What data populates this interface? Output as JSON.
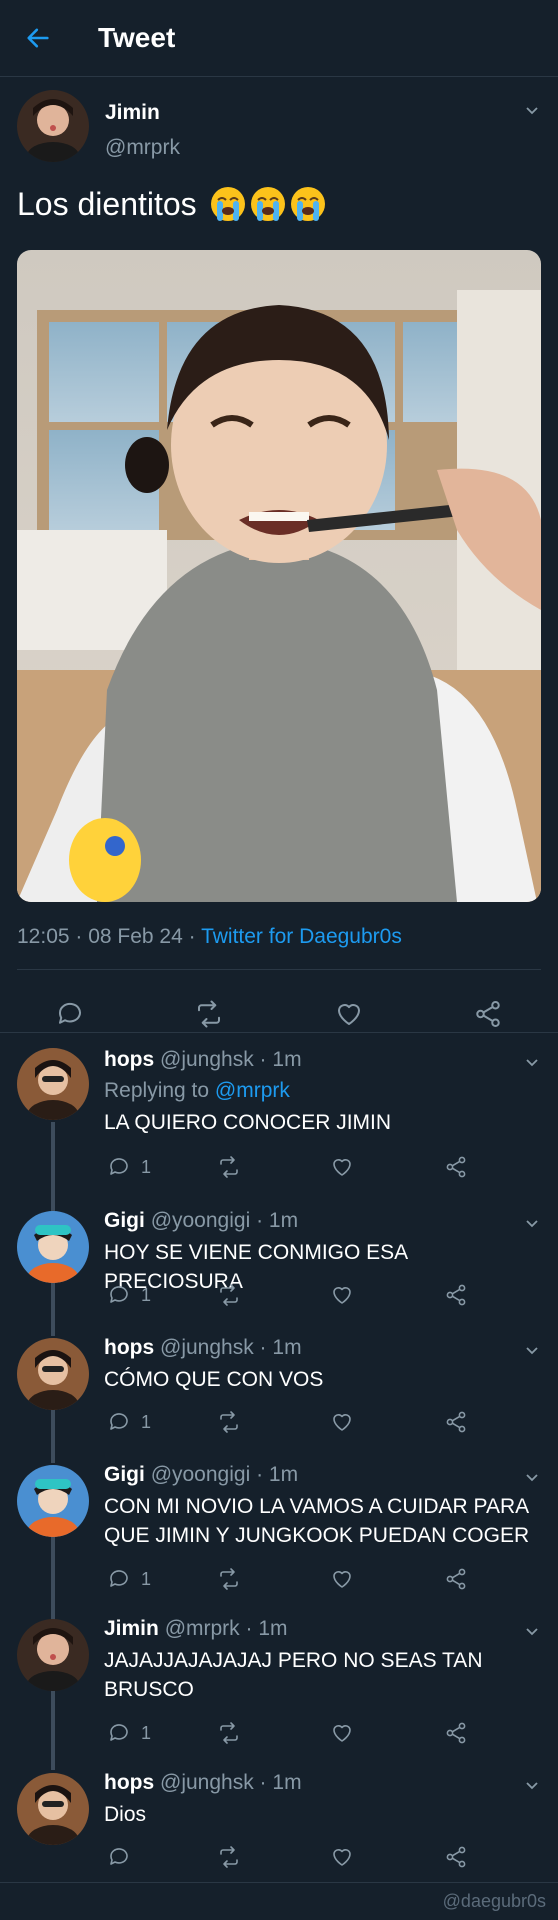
{
  "header": {
    "title": "Tweet",
    "back_icon": "arrow-left-icon"
  },
  "tweet": {
    "author_name": "Jimin",
    "author_handle": "@mrprk",
    "text": "Los dientitos",
    "emojis": [
      "loudly-crying-face",
      "loudly-crying-face",
      "loudly-crying-face"
    ],
    "time": "12:05 · 08 Feb 24 · ",
    "source": "Twitter for Daegubr0s",
    "photo_alt": "photo"
  },
  "replies": [
    {
      "name": "hops",
      "handle": "@junghsk",
      "time": "1m",
      "replying_label": "Replying to ",
      "replying_to": "@mrprk",
      "text": "LA QUIERO CONOCER JIMIN",
      "reply_count": "1"
    },
    {
      "name": "Gigi",
      "handle": "@yoongigi",
      "time": "1m",
      "text": "HOY SE VIENE CONMIGO ESA PRECIOSURA",
      "reply_count": "1"
    },
    {
      "name": "hops",
      "handle": "@junghsk",
      "time": "1m",
      "text": "CÓMO QUE CON VOS",
      "reply_count": "1"
    },
    {
      "name": "Gigi",
      "handle": "@yoongigi",
      "time": "1m",
      "text": "CON MI NOVIO LA VAMOS A CUIDAR PARA QUE JIMIN Y JUNGKOOK PUEDAN COGER",
      "reply_count": "1"
    },
    {
      "name": "Jimin",
      "handle": "@mrprk",
      "time": "1m",
      "text": "JAJAJJAJAJAJAJ PERO NO SEAS TAN BRUSCO",
      "reply_count": "1"
    },
    {
      "name": "hops",
      "handle": "@junghsk",
      "time": "1m",
      "text": "Dios",
      "reply_count": ""
    }
  ],
  "watermark": "@daegubr0s",
  "colors": {
    "background": "#15202b",
    "accent": "#1d9bf0",
    "muted": "#8899a6",
    "divider": "#2a3744"
  }
}
